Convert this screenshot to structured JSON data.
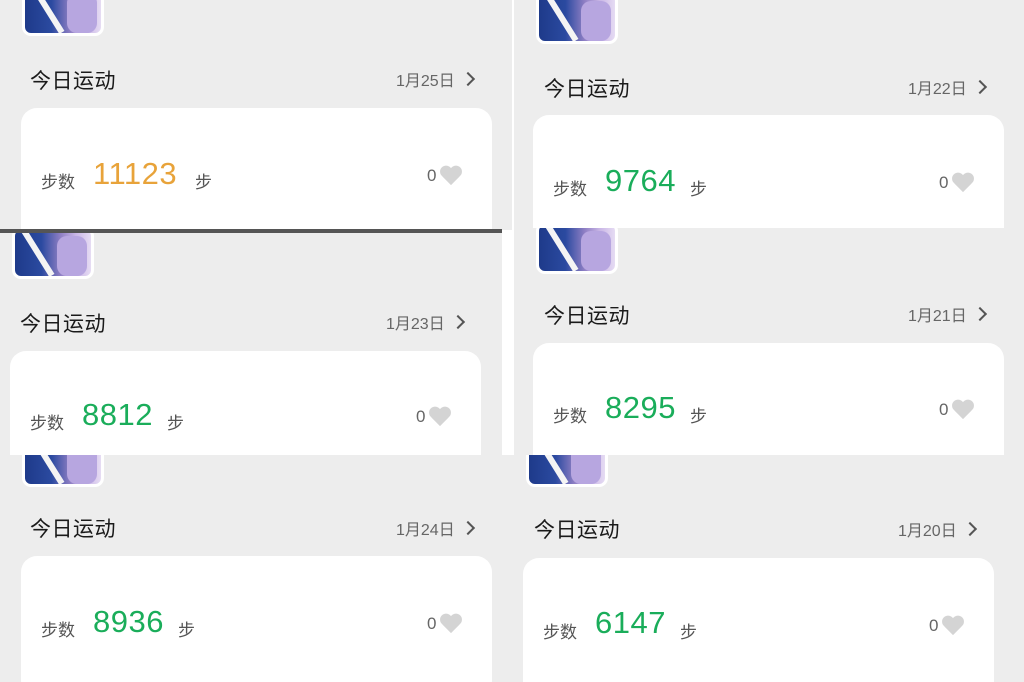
{
  "colors": {
    "highlight_steps": "#e8a33a",
    "normal_steps": "#1aad5a"
  },
  "panels": [
    {
      "title": "今日运动",
      "date": "1月25日",
      "steps_label": "步数",
      "steps": "11123",
      "unit": "步",
      "likes": "0",
      "highlight": true
    },
    {
      "title": "今日运动",
      "date": "1月22日",
      "steps_label": "步数",
      "steps": "9764",
      "unit": "步",
      "likes": "0",
      "highlight": false
    },
    {
      "title": "今日运动",
      "date": "1月23日",
      "steps_label": "步数",
      "steps": "8812",
      "unit": "步",
      "likes": "0",
      "highlight": false
    },
    {
      "title": "今日运动",
      "date": "1月21日",
      "steps_label": "步数",
      "steps": "8295",
      "unit": "步",
      "likes": "0",
      "highlight": false
    },
    {
      "title": "今日运动",
      "date": "1月24日",
      "steps_label": "步数",
      "steps": "8936",
      "unit": "步",
      "likes": "0",
      "highlight": false
    },
    {
      "title": "今日运动",
      "date": "1月20日",
      "steps_label": "步数",
      "steps": "6147",
      "unit": "步",
      "likes": "0",
      "highlight": false
    }
  ]
}
